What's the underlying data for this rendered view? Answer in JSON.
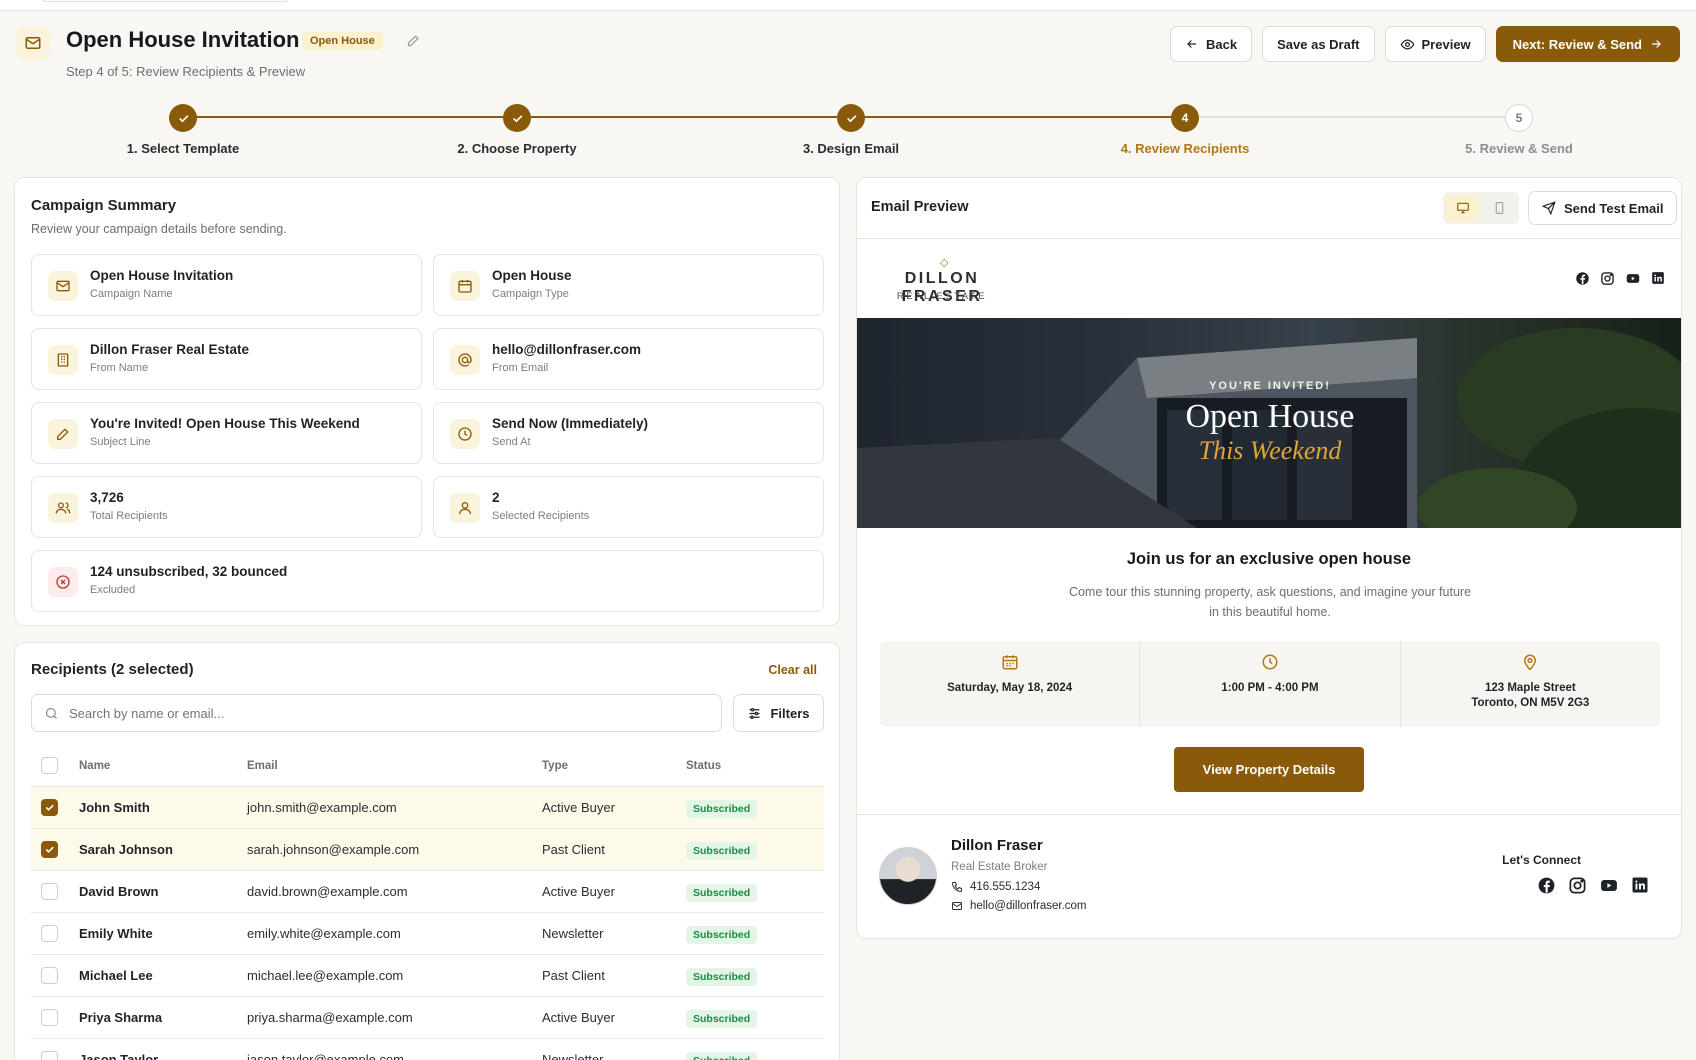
{
  "header": {
    "title": "Open House Invitation",
    "badge": "Open House",
    "subtitle": "Step 4 of 5: Review Recipients & Preview",
    "actions": {
      "back": "Back",
      "save_draft": "Save as Draft",
      "preview": "Preview",
      "next": "Next: Review & Send"
    }
  },
  "stepper": {
    "steps": [
      {
        "label": "1. Select Template",
        "number": "1",
        "state": "done"
      },
      {
        "label": "2. Choose Property",
        "number": "2",
        "state": "done"
      },
      {
        "label": "3. Design Email",
        "number": "3",
        "state": "done"
      },
      {
        "label": "4. Review Recipients",
        "number": "4",
        "state": "active"
      },
      {
        "label": "5. Review & Send",
        "number": "5",
        "state": "pending"
      }
    ]
  },
  "summary": {
    "title": "Campaign Summary",
    "subtitle": "Review your campaign details before sending.",
    "tiles": [
      {
        "value": "Open House Invitation",
        "label": "Campaign Name",
        "icon": "mail-icon"
      },
      {
        "value": "Open House",
        "label": "Campaign Type",
        "icon": "calendar-icon"
      },
      {
        "value": "Dillon Fraser Real Estate",
        "label": "From Name",
        "icon": "building-icon"
      },
      {
        "value": "hello@dillonfraser.com",
        "label": "From Email",
        "icon": "at-icon"
      },
      {
        "value": "You're Invited! Open House This Weekend",
        "label": "Subject Line",
        "icon": "pencil-icon"
      },
      {
        "value": "Send Now (Immediately)",
        "label": "Send At",
        "icon": "clock-icon"
      },
      {
        "value": "3,726",
        "label": "Total Recipients",
        "icon": "users-icon"
      },
      {
        "value": "2",
        "label": "Selected Recipients",
        "icon": "user-icon"
      },
      {
        "value": "124 unsubscribed, 32 bounced",
        "label": "Excluded",
        "icon": "x-circle-icon"
      }
    ]
  },
  "recipients": {
    "title": "Recipients (2 selected)",
    "clear_all": "Clear all",
    "search_placeholder": "Search by name or email...",
    "filters": "Filters",
    "columns": {
      "name": "Name",
      "email": "Email",
      "type": "Type",
      "status": "Status"
    },
    "rows": [
      {
        "name": "John Smith",
        "email": "john.smith@example.com",
        "type": "Active Buyer",
        "status": "Subscribed",
        "selected": true
      },
      {
        "name": "Sarah Johnson",
        "email": "sarah.johnson@example.com",
        "type": "Past Client",
        "status": "Subscribed",
        "selected": true
      },
      {
        "name": "David Brown",
        "email": "david.brown@example.com",
        "type": "Active Buyer",
        "status": "Subscribed",
        "selected": false
      },
      {
        "name": "Emily White",
        "email": "emily.white@example.com",
        "type": "Newsletter",
        "status": "Subscribed",
        "selected": false
      },
      {
        "name": "Michael Lee",
        "email": "michael.lee@example.com",
        "type": "Past Client",
        "status": "Subscribed",
        "selected": false
      },
      {
        "name": "Priya Sharma",
        "email": "priya.sharma@example.com",
        "type": "Active Buyer",
        "status": "Subscribed",
        "selected": false
      },
      {
        "name": "Jason Taylor",
        "email": "jason.taylor@example.com",
        "type": "Newsletter",
        "status": "Subscribed",
        "selected": false
      }
    ]
  },
  "preview": {
    "title": "Email Preview",
    "send_test": "Send Test Email",
    "brand_line1": "DILLON FRASER",
    "brand_line2": "REAL ESTATE",
    "hero_kicker": "YOU'RE INVITED!",
    "hero_title": "Open House",
    "hero_subtitle": "This Weekend",
    "heading": "Join us for an exclusive open house",
    "body": "Come tour this stunning property, ask questions, and imagine your future in this beautiful home.",
    "details": {
      "date": "Saturday, May 18, 2024",
      "time": "1:00 PM - 4:00 PM",
      "address_line1": "123 Maple Street",
      "address_line2": "Toronto, ON M5V 2G3"
    },
    "cta": "View Property Details",
    "agent": {
      "name": "Dillon Fraser",
      "role": "Real Estate Broker",
      "phone": "416.555.1234",
      "email": "hello@dillonfraser.com"
    },
    "connect": "Let's Connect"
  },
  "colors": {
    "accent": "#8a5a0b",
    "accent_light": "#fbf4dd",
    "success": "#1e8a43"
  }
}
